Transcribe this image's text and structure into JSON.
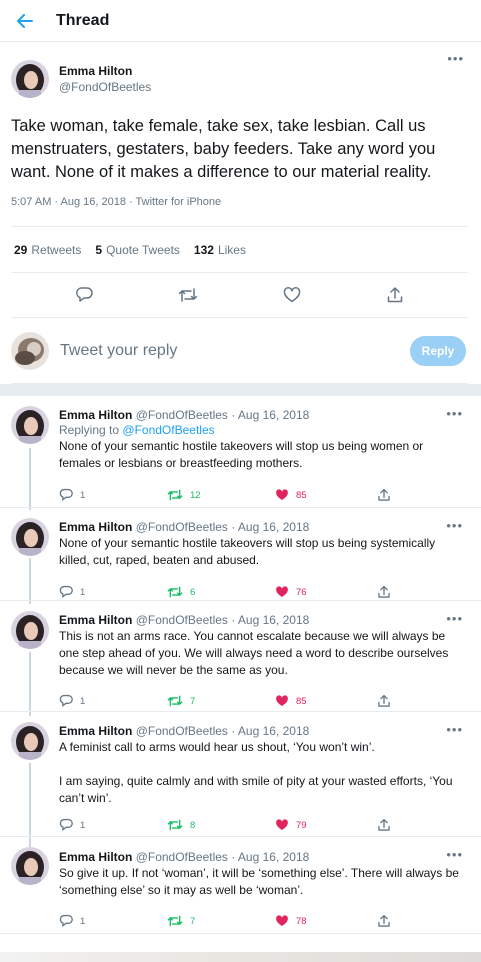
{
  "header": {
    "title": "Thread",
    "back_icon": "arrow-left-icon"
  },
  "main_tweet": {
    "display_name": "Emma Hilton",
    "handle": "@FondOfBeetles",
    "text": "Take woman, take female, take sex, take lesbian. Call us menstruaters, gestaters, baby feeders. Take any word you want. None of it makes a difference to our material reality.",
    "meta": "5:07 AM · Aug 16, 2018 · Twitter for iPhone",
    "retweets_count": "29",
    "retweets_label": "Retweets",
    "quotes_count": "5",
    "quotes_label": "Quote Tweets",
    "likes_count": "132",
    "likes_label": "Likes"
  },
  "reply_box": {
    "placeholder": "Tweet your reply",
    "button": "Reply"
  },
  "replies": [
    {
      "name": "Emma Hilton",
      "handle_date": "@FondOfBeetles · Aug 16, 2018",
      "replying_prefix": "Replying to",
      "replying_to": "@FondOfBeetles",
      "paragraphs": [
        "None of your semantic hostile takeovers will stop us being women or females or lesbians or breastfeeding mothers."
      ],
      "replies": "1",
      "retweets": "12",
      "likes": "85"
    },
    {
      "name": "Emma Hilton",
      "handle_date": "@FondOfBeetles · Aug 16, 2018",
      "paragraphs": [
        "None of your semantic hostile takeovers will stop us being systemically killed, cut, raped, beaten and abused."
      ],
      "replies": "1",
      "retweets": "6",
      "likes": "76"
    },
    {
      "name": "Emma Hilton",
      "handle_date": "@FondOfBeetles · Aug 16, 2018",
      "paragraphs": [
        "This is not an arms race. You cannot escalate because we will always be one step ahead of you. We will always need a word to describe ourselves because we will never be the same as you."
      ],
      "replies": "1",
      "retweets": "7",
      "likes": "85"
    },
    {
      "name": "Emma Hilton",
      "handle_date": "@FondOfBeetles · Aug 16, 2018",
      "paragraphs": [
        "A feminist call to arms would hear us shout, ‘You won’t win’.",
        "I am saying, quite calmly and with smile of pity at your wasted efforts, ‘You can’t win’."
      ],
      "replies": "1",
      "retweets": "8",
      "likes": "79"
    },
    {
      "name": "Emma Hilton",
      "handle_date": "@FondOfBeetles · Aug 16, 2018",
      "paragraphs": [
        "So give it up. If not ‘woman’, it will be ‘something else’. There will always be ‘something else’ so it may as well be ‘woman’."
      ],
      "replies": "1",
      "retweets": "7",
      "likes": "78"
    }
  ],
  "colors": {
    "accent": "#1da1f2",
    "retweet": "#17bf63",
    "like": "#e0245e",
    "muted": "#657786",
    "reply_button": "#9ad0f5"
  }
}
